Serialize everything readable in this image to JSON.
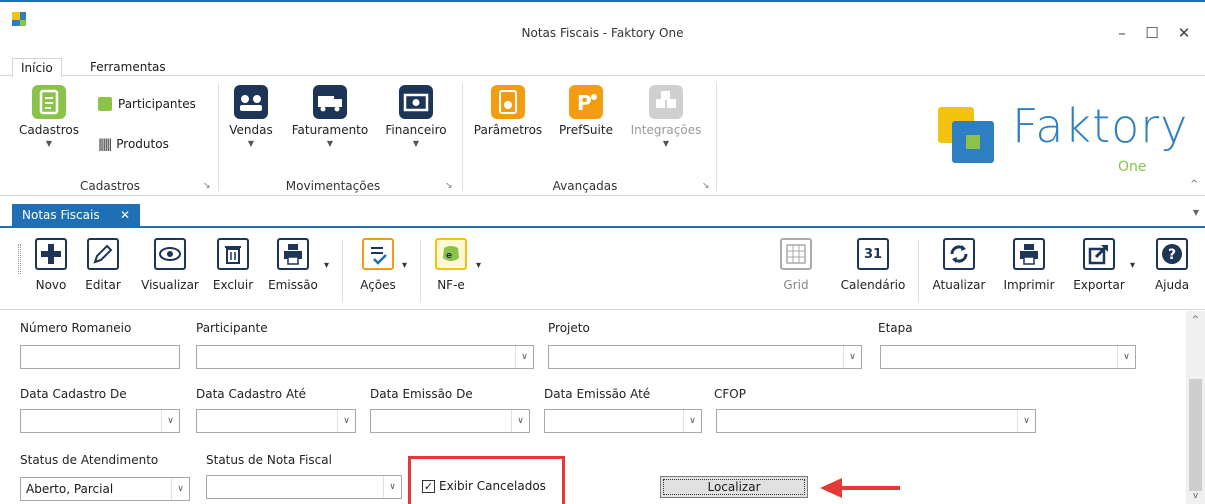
{
  "window": {
    "title": "Notas Fiscais - Faktory One",
    "minimize": "–",
    "maximize": "☐",
    "close": "✕"
  },
  "menu_tabs": [
    "Início",
    "Ferramentas"
  ],
  "ribbon": {
    "groups": {
      "cadastros": {
        "label": "Cadastros",
        "big": "Cadastros",
        "participantes": "Participantes",
        "produtos": "Produtos"
      },
      "movimentacoes": {
        "label": "Movimentações",
        "vendas": "Vendas",
        "faturamento": "Faturamento",
        "financeiro": "Financeiro"
      },
      "avancadas": {
        "label": "Avançadas",
        "parametros": "Parâmetros",
        "prefsuite": "PrefSuite",
        "integracoes": "Integrações"
      }
    },
    "logo": {
      "text": "Faktory",
      "sub": "One"
    }
  },
  "doc_tab": {
    "label": "Notas Fiscais",
    "close": "✕"
  },
  "toolbar": {
    "novo": "Novo",
    "editar": "Editar",
    "visualizar": "Visualizar",
    "excluir": "Excluir",
    "emissao": "Emissão",
    "acoes": "Ações",
    "nfe": "NF-e",
    "grid": "Grid",
    "calendario": "Calendário",
    "calendar_day": "31",
    "atualizar": "Atualizar",
    "imprimir": "Imprimir",
    "exportar": "Exportar",
    "ajuda": "Ajuda"
  },
  "form": {
    "numero_romaneio": {
      "label": "Número Romaneio",
      "value": ""
    },
    "participante": {
      "label": "Participante",
      "value": ""
    },
    "projeto": {
      "label": "Projeto",
      "value": ""
    },
    "etapa": {
      "label": "Etapa",
      "value": ""
    },
    "data_cadastro_de": {
      "label": "Data Cadastro De",
      "value": ""
    },
    "data_cadastro_ate": {
      "label": "Data Cadastro Até",
      "value": ""
    },
    "data_emissao_de": {
      "label": "Data Emissão De",
      "value": ""
    },
    "data_emissao_ate": {
      "label": "Data Emissão Até",
      "value": ""
    },
    "cfop": {
      "label": "CFOP",
      "value": ""
    },
    "status_atendimento": {
      "label": "Status de Atendimento",
      "value": "Aberto, Parcial"
    },
    "status_nota_fiscal": {
      "label": "Status de Nota Fiscal",
      "value": ""
    },
    "exibir_cancelados": {
      "label": "Exibir Cancelados",
      "checked": true
    },
    "localizar": "Localizar"
  },
  "colors": {
    "accent": "#1f6fb5",
    "highlight": "#e53935",
    "brand_yellow": "#f2c20c",
    "brand_green": "#8bc34a"
  }
}
